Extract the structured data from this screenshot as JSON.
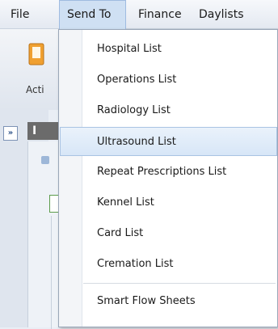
{
  "menubar": {
    "items": [
      {
        "label": "File"
      },
      {
        "label": "Send To"
      },
      {
        "label": "Finance"
      },
      {
        "label": "Daylists"
      }
    ]
  },
  "ribbon": {
    "button_label": "Acti"
  },
  "panel": {
    "expand_label": "»",
    "header_letter": "I"
  },
  "send_to_menu": {
    "items": [
      {
        "label": "Hospital List"
      },
      {
        "label": "Operations List"
      },
      {
        "label": "Radiology List"
      },
      {
        "label": "Ultrasound List",
        "highlighted": true
      },
      {
        "label": "Repeat Prescriptions List"
      },
      {
        "label": "Kennel List"
      },
      {
        "label": "Card List"
      },
      {
        "label": "Cremation List"
      },
      {
        "label": "Smart Flow Sheets"
      }
    ]
  },
  "colors": {
    "menu_highlight": "#cfe0f3",
    "item_hover": "#d7e6f7"
  }
}
